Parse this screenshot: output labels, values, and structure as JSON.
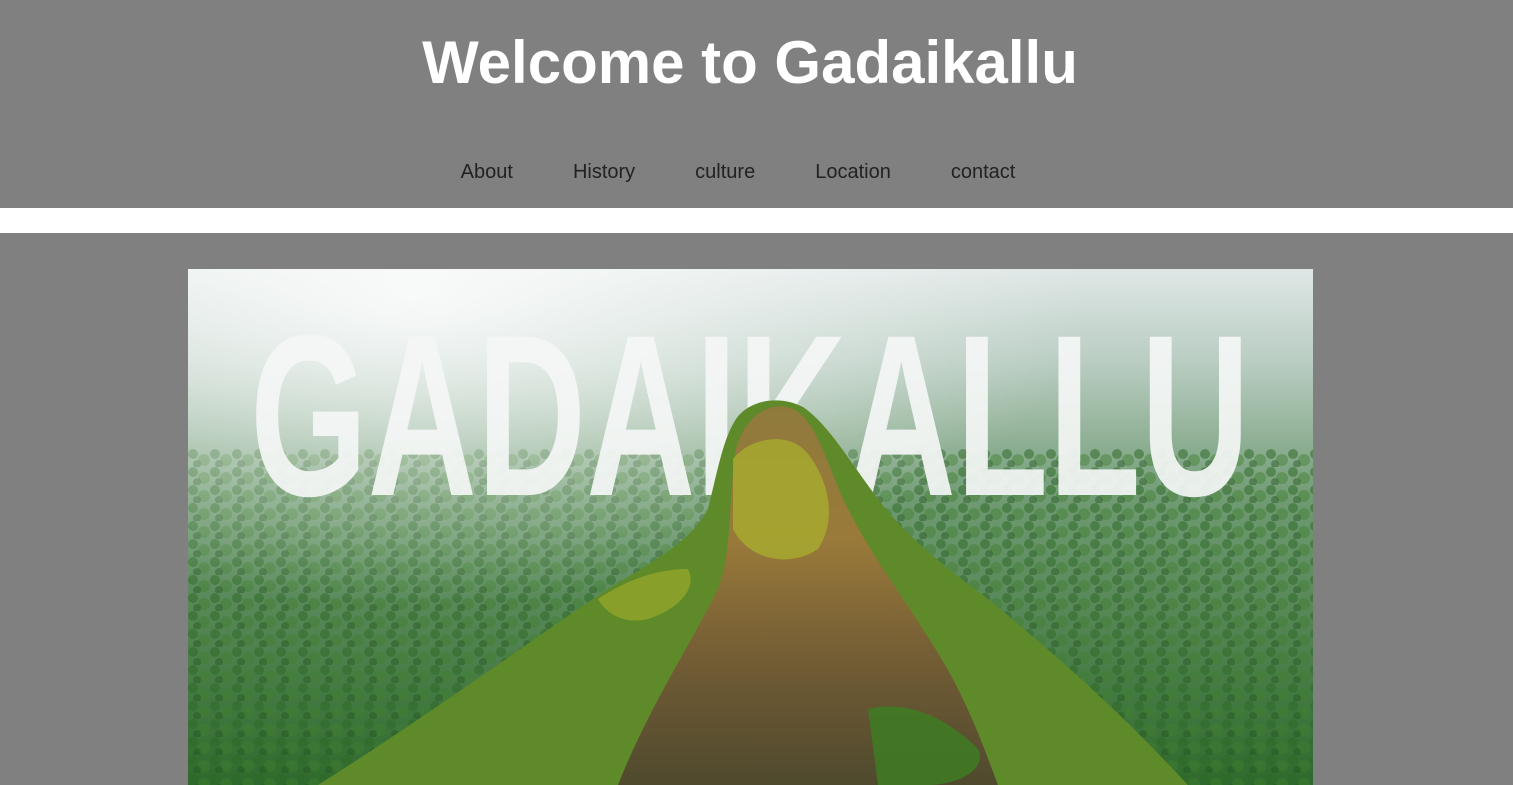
{
  "header": {
    "title": "Welcome to Gadaikallu",
    "background": "#808080",
    "title_color": "#ffffff"
  },
  "nav": {
    "items": [
      {
        "label": "About"
      },
      {
        "label": "History"
      },
      {
        "label": "culture"
      },
      {
        "label": "Location"
      },
      {
        "label": "contact"
      }
    ],
    "link_color": "#222222"
  },
  "hero": {
    "overlay_text": "GADAIKALLU",
    "description": "aerial-mountain-photo"
  }
}
